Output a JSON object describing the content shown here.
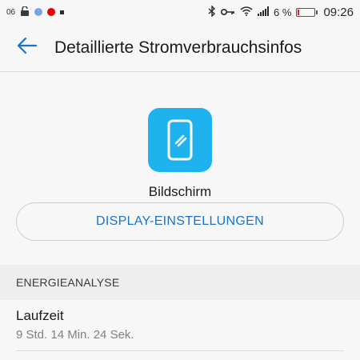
{
  "status_bar": {
    "left_small_text": "06",
    "signal_percent_text": "6 %",
    "time": "09:26",
    "icons": [
      "lock-open-icon",
      "messenger-icon",
      "vodafone-icon",
      "notification-dot-icon",
      "bluetooth-icon",
      "key-icon",
      "wifi-icon",
      "signal-icon",
      "battery-low-icon"
    ]
  },
  "header": {
    "title": "Detaillierte Stromverbrauchsinfos",
    "back_icon": "arrow-back-icon"
  },
  "app": {
    "icon": "phone-display-icon",
    "icon_color": "#1eb2ee",
    "name": "Bildschirm"
  },
  "actions": {
    "display_settings_label": "DISPLAY-EINSTELLUNGEN",
    "accent_color": "#1a73c9"
  },
  "section": {
    "header": "ENERGIEANALYSE"
  },
  "items": [
    {
      "title": "Laufzeit",
      "subtitle": "9 Std. 14 Min. 24 Sek."
    }
  ]
}
